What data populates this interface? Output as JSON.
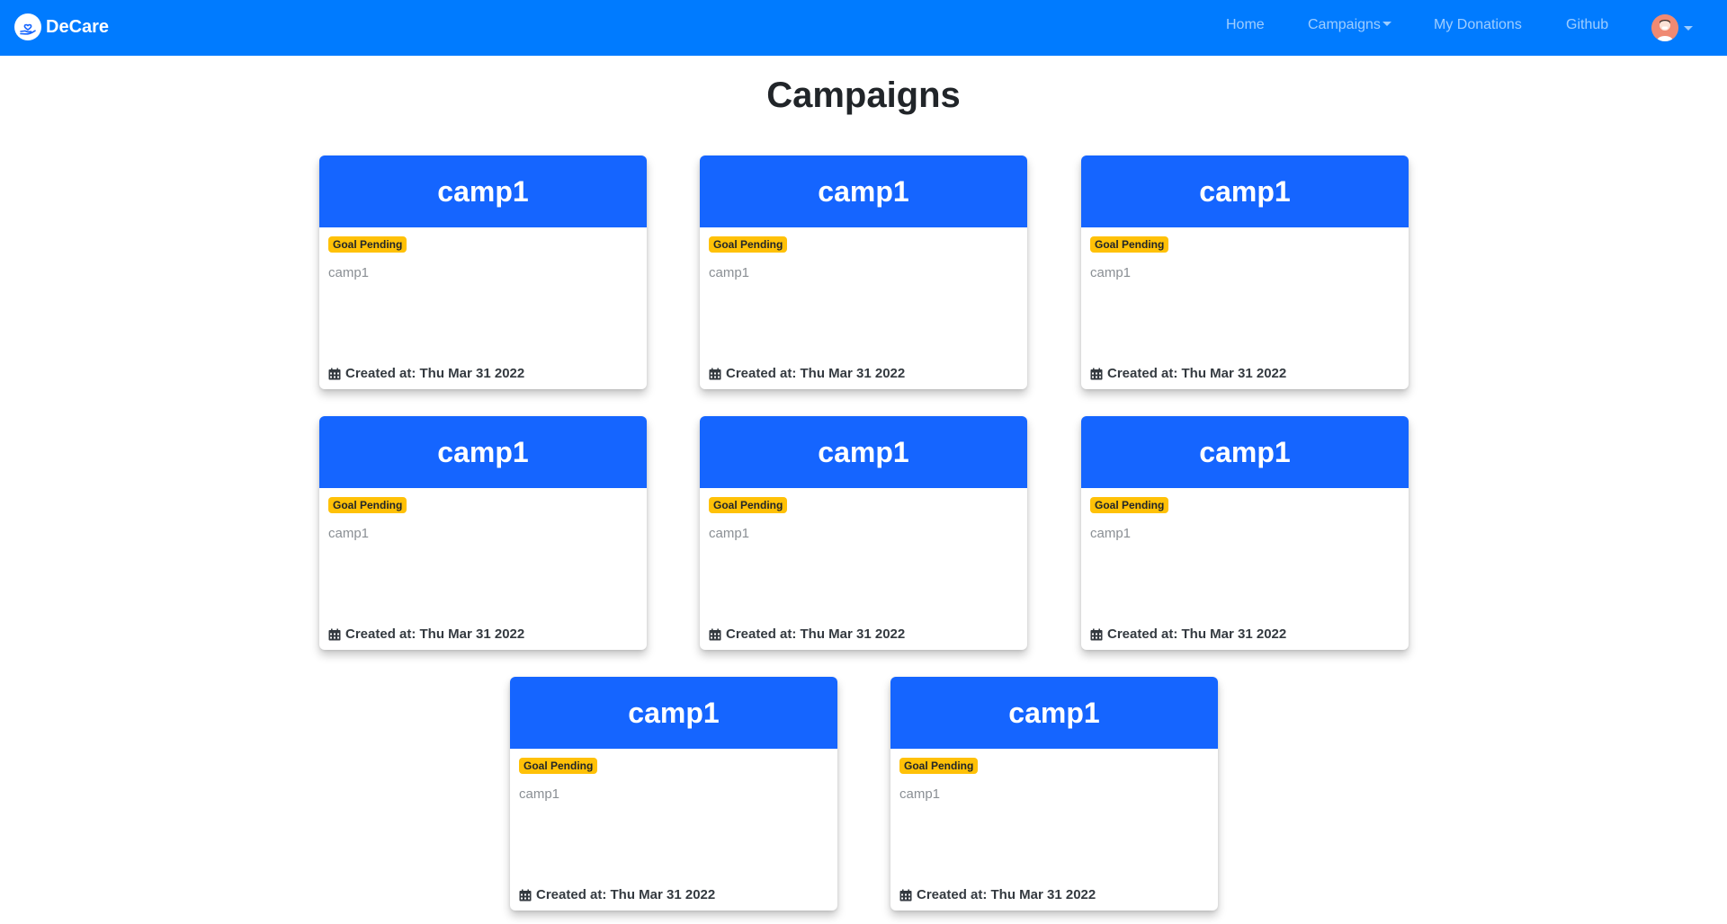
{
  "navbar": {
    "brand": "DeCare",
    "links": {
      "home": "Home",
      "campaigns": "Campaigns",
      "my_donations": "My Donations",
      "github": "Github"
    }
  },
  "page": {
    "title": "Campaigns"
  },
  "cards": [
    {
      "title": "camp1",
      "badge": "Goal Pending",
      "description": "camp1",
      "created": "Created at: Thu Mar 31 2022"
    },
    {
      "title": "camp1",
      "badge": "Goal Pending",
      "description": "camp1",
      "created": "Created at: Thu Mar 31 2022"
    },
    {
      "title": "camp1",
      "badge": "Goal Pending",
      "description": "camp1",
      "created": "Created at: Thu Mar 31 2022"
    },
    {
      "title": "camp1",
      "badge": "Goal Pending",
      "description": "camp1",
      "created": "Created at: Thu Mar 31 2022"
    },
    {
      "title": "camp1",
      "badge": "Goal Pending",
      "description": "camp1",
      "created": "Created at: Thu Mar 31 2022"
    },
    {
      "title": "camp1",
      "badge": "Goal Pending",
      "description": "camp1",
      "created": "Created at: Thu Mar 31 2022"
    },
    {
      "title": "camp1",
      "badge": "Goal Pending",
      "description": "camp1",
      "created": "Created at: Thu Mar 31 2022"
    },
    {
      "title": "camp1",
      "badge": "Goal Pending",
      "description": "camp1",
      "created": "Created at: Thu Mar 31 2022"
    }
  ],
  "icons": {
    "brand": "heart-hand-logo-icon",
    "calendar": "calendar-icon",
    "avatar": "user-avatar-icon",
    "caret": "chevron-down-icon"
  },
  "colors": {
    "navbar_bg": "#007bff",
    "card_header_bg": "#1565ff",
    "badge_bg": "#ffc107"
  }
}
